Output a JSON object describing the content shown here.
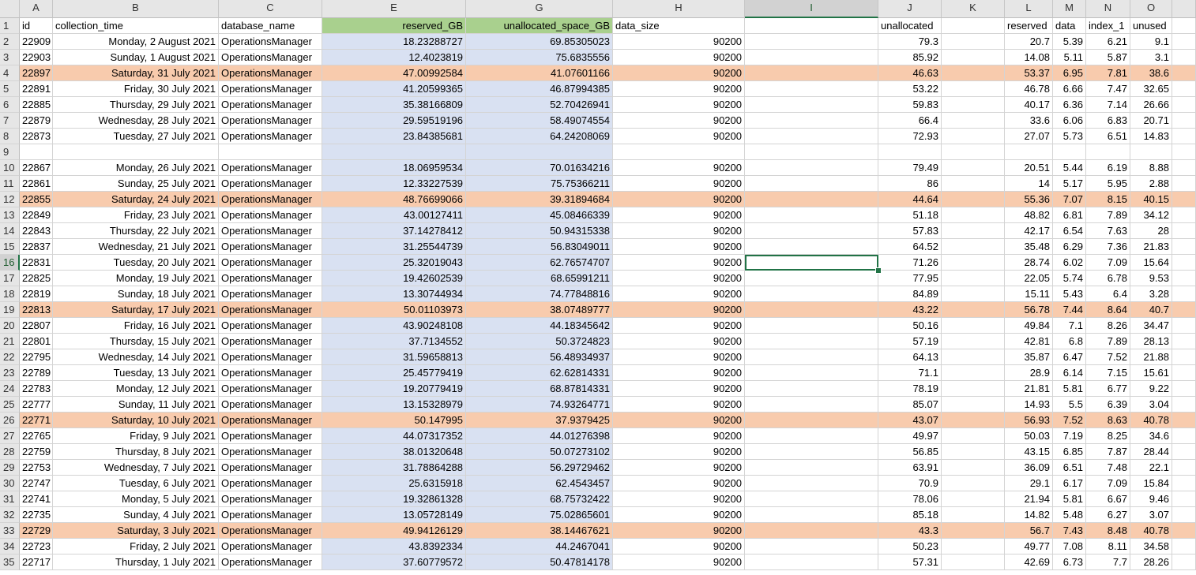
{
  "columns": [
    "A",
    "B",
    "C",
    "",
    "E",
    "",
    "G",
    "H",
    "I",
    "J",
    "K",
    "L",
    "M",
    "N",
    "O"
  ],
  "selected": {
    "column": "I",
    "row": "16"
  },
  "header_row": {
    "rownum": "1",
    "cells": [
      "id",
      "collection_time",
      "database_name",
      "reserved_GB",
      "unallocated_space_GB",
      "data_size",
      "",
      "unallocated",
      "",
      "reserved",
      "data",
      "index_1",
      "unused"
    ]
  },
  "rows": [
    {
      "n": "2",
      "id": "22909",
      "time": "Monday, 2 August 2021",
      "db": "OperationsManager",
      "res": "18.23288727",
      "unalloc": "69.85305023",
      "size": "90200",
      "j": "79.3",
      "l": "20.7",
      "m": "5.39",
      "nn": "6.21",
      "o": "9.1",
      "hl": false
    },
    {
      "n": "3",
      "id": "22903",
      "time": "Sunday, 1 August 2021",
      "db": "OperationsManager",
      "res": "12.4023819",
      "unalloc": "75.6835556",
      "size": "90200",
      "j": "85.92",
      "l": "14.08",
      "m": "5.11",
      "nn": "5.87",
      "o": "3.1",
      "hl": false
    },
    {
      "n": "4",
      "id": "22897",
      "time": "Saturday, 31 July 2021",
      "db": "OperationsManager",
      "res": "47.00992584",
      "unalloc": "41.07601166",
      "size": "90200",
      "j": "46.63",
      "l": "53.37",
      "m": "6.95",
      "nn": "7.81",
      "o": "38.6",
      "hl": true
    },
    {
      "n": "5",
      "id": "22891",
      "time": "Friday, 30 July 2021",
      "db": "OperationsManager",
      "res": "41.20599365",
      "unalloc": "46.87994385",
      "size": "90200",
      "j": "53.22",
      "l": "46.78",
      "m": "6.66",
      "nn": "7.47",
      "o": "32.65",
      "hl": false
    },
    {
      "n": "6",
      "id": "22885",
      "time": "Thursday, 29 July 2021",
      "db": "OperationsManager",
      "res": "35.38166809",
      "unalloc": "52.70426941",
      "size": "90200",
      "j": "59.83",
      "l": "40.17",
      "m": "6.36",
      "nn": "7.14",
      "o": "26.66",
      "hl": false
    },
    {
      "n": "7",
      "id": "22879",
      "time": "Wednesday, 28 July 2021",
      "db": "OperationsManager",
      "res": "29.59519196",
      "unalloc": "58.49074554",
      "size": "90200",
      "j": "66.4",
      "l": "33.6",
      "m": "6.06",
      "nn": "6.83",
      "o": "20.71",
      "hl": false
    },
    {
      "n": "8",
      "id": "22873",
      "time": "Tuesday, 27 July 2021",
      "db": "OperationsManager",
      "res": "23.84385681",
      "unalloc": "64.24208069",
      "size": "90200",
      "j": "72.93",
      "l": "27.07",
      "m": "5.73",
      "nn": "6.51",
      "o": "14.83",
      "hl": false
    },
    {
      "n": "9",
      "id": "",
      "time": "",
      "db": "",
      "res": "",
      "unalloc": "",
      "size": "",
      "j": "",
      "l": "",
      "m": "",
      "nn": "",
      "o": "",
      "hl": false
    },
    {
      "n": "10",
      "id": "22867",
      "time": "Monday, 26 July 2021",
      "db": "OperationsManager",
      "res": "18.06959534",
      "unalloc": "70.01634216",
      "size": "90200",
      "j": "79.49",
      "l": "20.51",
      "m": "5.44",
      "nn": "6.19",
      "o": "8.88",
      "hl": false
    },
    {
      "n": "11",
      "id": "22861",
      "time": "Sunday, 25 July 2021",
      "db": "OperationsManager",
      "res": "12.33227539",
      "unalloc": "75.75366211",
      "size": "90200",
      "j": "86",
      "l": "14",
      "m": "5.17",
      "nn": "5.95",
      "o": "2.88",
      "hl": false
    },
    {
      "n": "12",
      "id": "22855",
      "time": "Saturday, 24 July 2021",
      "db": "OperationsManager",
      "res": "48.76699066",
      "unalloc": "39.31894684",
      "size": "90200",
      "j": "44.64",
      "l": "55.36",
      "m": "7.07",
      "nn": "8.15",
      "o": "40.15",
      "hl": true
    },
    {
      "n": "13",
      "id": "22849",
      "time": "Friday, 23 July 2021",
      "db": "OperationsManager",
      "res": "43.00127411",
      "unalloc": "45.08466339",
      "size": "90200",
      "j": "51.18",
      "l": "48.82",
      "m": "6.81",
      "nn": "7.89",
      "o": "34.12",
      "hl": false
    },
    {
      "n": "14",
      "id": "22843",
      "time": "Thursday, 22 July 2021",
      "db": "OperationsManager",
      "res": "37.14278412",
      "unalloc": "50.94315338",
      "size": "90200",
      "j": "57.83",
      "l": "42.17",
      "m": "6.54",
      "nn": "7.63",
      "o": "28",
      "hl": false
    },
    {
      "n": "15",
      "id": "22837",
      "time": "Wednesday, 21 July 2021",
      "db": "OperationsManager",
      "res": "31.25544739",
      "unalloc": "56.83049011",
      "size": "90200",
      "j": "64.52",
      "l": "35.48",
      "m": "6.29",
      "nn": "7.36",
      "o": "21.83",
      "hl": false
    },
    {
      "n": "16",
      "id": "22831",
      "time": "Tuesday, 20 July 2021",
      "db": "OperationsManager",
      "res": "25.32019043",
      "unalloc": "62.76574707",
      "size": "90200",
      "j": "71.26",
      "l": "28.74",
      "m": "6.02",
      "nn": "7.09",
      "o": "15.64",
      "hl": false
    },
    {
      "n": "17",
      "id": "22825",
      "time": "Monday, 19 July 2021",
      "db": "OperationsManager",
      "res": "19.42602539",
      "unalloc": "68.65991211",
      "size": "90200",
      "j": "77.95",
      "l": "22.05",
      "m": "5.74",
      "nn": "6.78",
      "o": "9.53",
      "hl": false
    },
    {
      "n": "18",
      "id": "22819",
      "time": "Sunday, 18 July 2021",
      "db": "OperationsManager",
      "res": "13.30744934",
      "unalloc": "74.77848816",
      "size": "90200",
      "j": "84.89",
      "l": "15.11",
      "m": "5.43",
      "nn": "6.4",
      "o": "3.28",
      "hl": false
    },
    {
      "n": "19",
      "id": "22813",
      "time": "Saturday, 17 July 2021",
      "db": "OperationsManager",
      "res": "50.01103973",
      "unalloc": "38.07489777",
      "size": "90200",
      "j": "43.22",
      "l": "56.78",
      "m": "7.44",
      "nn": "8.64",
      "o": "40.7",
      "hl": true
    },
    {
      "n": "20",
      "id": "22807",
      "time": "Friday, 16 July 2021",
      "db": "OperationsManager",
      "res": "43.90248108",
      "unalloc": "44.18345642",
      "size": "90200",
      "j": "50.16",
      "l": "49.84",
      "m": "7.1",
      "nn": "8.26",
      "o": "34.47",
      "hl": false
    },
    {
      "n": "21",
      "id": "22801",
      "time": "Thursday, 15 July 2021",
      "db": "OperationsManager",
      "res": "37.7134552",
      "unalloc": "50.3724823",
      "size": "90200",
      "j": "57.19",
      "l": "42.81",
      "m": "6.8",
      "nn": "7.89",
      "o": "28.13",
      "hl": false
    },
    {
      "n": "22",
      "id": "22795",
      "time": "Wednesday, 14 July 2021",
      "db": "OperationsManager",
      "res": "31.59658813",
      "unalloc": "56.48934937",
      "size": "90200",
      "j": "64.13",
      "l": "35.87",
      "m": "6.47",
      "nn": "7.52",
      "o": "21.88",
      "hl": false
    },
    {
      "n": "23",
      "id": "22789",
      "time": "Tuesday, 13 July 2021",
      "db": "OperationsManager",
      "res": "25.45779419",
      "unalloc": "62.62814331",
      "size": "90200",
      "j": "71.1",
      "l": "28.9",
      "m": "6.14",
      "nn": "7.15",
      "o": "15.61",
      "hl": false
    },
    {
      "n": "24",
      "id": "22783",
      "time": "Monday, 12 July 2021",
      "db": "OperationsManager",
      "res": "19.20779419",
      "unalloc": "68.87814331",
      "size": "90200",
      "j": "78.19",
      "l": "21.81",
      "m": "5.81",
      "nn": "6.77",
      "o": "9.22",
      "hl": false
    },
    {
      "n": "25",
      "id": "22777",
      "time": "Sunday, 11 July 2021",
      "db": "OperationsManager",
      "res": "13.15328979",
      "unalloc": "74.93264771",
      "size": "90200",
      "j": "85.07",
      "l": "14.93",
      "m": "5.5",
      "nn": "6.39",
      "o": "3.04",
      "hl": false
    },
    {
      "n": "26",
      "id": "22771",
      "time": "Saturday, 10 July 2021",
      "db": "OperationsManager",
      "res": "50.147995",
      "unalloc": "37.9379425",
      "size": "90200",
      "j": "43.07",
      "l": "56.93",
      "m": "7.52",
      "nn": "8.63",
      "o": "40.78",
      "hl": true
    },
    {
      "n": "27",
      "id": "22765",
      "time": "Friday, 9 July 2021",
      "db": "OperationsManager",
      "res": "44.07317352",
      "unalloc": "44.01276398",
      "size": "90200",
      "j": "49.97",
      "l": "50.03",
      "m": "7.19",
      "nn": "8.25",
      "o": "34.6",
      "hl": false
    },
    {
      "n": "28",
      "id": "22759",
      "time": "Thursday, 8 July 2021",
      "db": "OperationsManager",
      "res": "38.01320648",
      "unalloc": "50.07273102",
      "size": "90200",
      "j": "56.85",
      "l": "43.15",
      "m": "6.85",
      "nn": "7.87",
      "o": "28.44",
      "hl": false
    },
    {
      "n": "29",
      "id": "22753",
      "time": "Wednesday, 7 July 2021",
      "db": "OperationsManager",
      "res": "31.78864288",
      "unalloc": "56.29729462",
      "size": "90200",
      "j": "63.91",
      "l": "36.09",
      "m": "6.51",
      "nn": "7.48",
      "o": "22.1",
      "hl": false
    },
    {
      "n": "30",
      "id": "22747",
      "time": "Tuesday, 6 July 2021",
      "db": "OperationsManager",
      "res": "25.6315918",
      "unalloc": "62.4543457",
      "size": "90200",
      "j": "70.9",
      "l": "29.1",
      "m": "6.17",
      "nn": "7.09",
      "o": "15.84",
      "hl": false
    },
    {
      "n": "31",
      "id": "22741",
      "time": "Monday, 5 July 2021",
      "db": "OperationsManager",
      "res": "19.32861328",
      "unalloc": "68.75732422",
      "size": "90200",
      "j": "78.06",
      "l": "21.94",
      "m": "5.81",
      "nn": "6.67",
      "o": "9.46",
      "hl": false
    },
    {
      "n": "32",
      "id": "22735",
      "time": "Sunday, 4 July 2021",
      "db": "OperationsManager",
      "res": "13.05728149",
      "unalloc": "75.02865601",
      "size": "90200",
      "j": "85.18",
      "l": "14.82",
      "m": "5.48",
      "nn": "6.27",
      "o": "3.07",
      "hl": false
    },
    {
      "n": "33",
      "id": "22729",
      "time": "Saturday, 3 July 2021",
      "db": "OperationsManager",
      "res": "49.94126129",
      "unalloc": "38.14467621",
      "size": "90200",
      "j": "43.3",
      "l": "56.7",
      "m": "7.43",
      "nn": "8.48",
      "o": "40.78",
      "hl": true
    },
    {
      "n": "34",
      "id": "22723",
      "time": "Friday, 2 July 2021",
      "db": "OperationsManager",
      "res": "43.8392334",
      "unalloc": "44.2467041",
      "size": "90200",
      "j": "50.23",
      "l": "49.77",
      "m": "7.08",
      "nn": "8.11",
      "o": "34.58",
      "hl": false
    },
    {
      "n": "35",
      "id": "22717",
      "time": "Thursday, 1 July 2021",
      "db": "OperationsManager",
      "res": "37.60779572",
      "unalloc": "50.47814178",
      "size": "90200",
      "j": "57.31",
      "l": "42.69",
      "m": "6.73",
      "nn": "7.7",
      "o": "28.26",
      "hl": false
    }
  ],
  "colors": {
    "header_green": "#a9d08e",
    "column_blue": "#d9e1f2",
    "row_peach": "#f8cbad",
    "selection": "#217346"
  }
}
